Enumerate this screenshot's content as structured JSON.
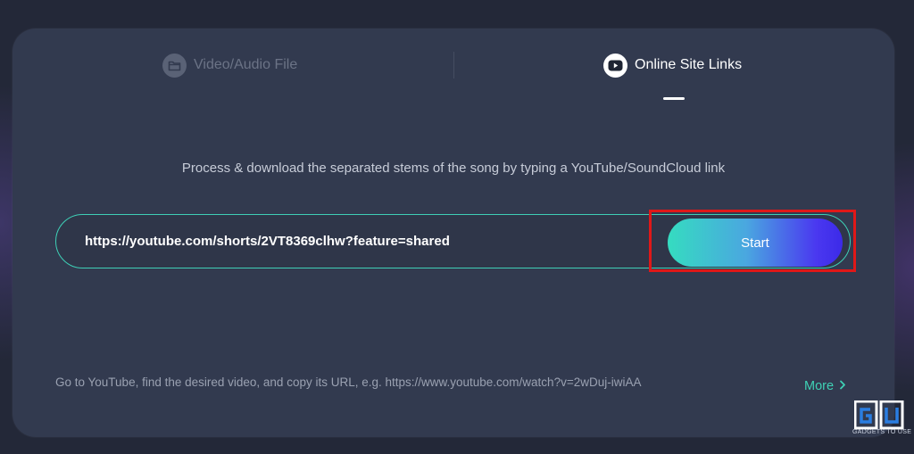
{
  "tabs": [
    {
      "label": "Video/Audio File",
      "icon": "folder-icon",
      "active": false
    },
    {
      "label": "Online Site Links",
      "icon": "youtube-play-icon",
      "active": true
    }
  ],
  "main": {
    "description": "Process & download the separated stems of the song by typing a YouTube/SoundCloud link",
    "url_value": "https://youtube.com/shorts/2VT8369clhw?feature=shared",
    "start_label": "Start",
    "hint": "Go to YouTube, find the desired video, and copy its URL, e.g. https://www.youtube.com/watch?v=2wDuj-iwiAA",
    "more_label": "More"
  },
  "watermark": {
    "logo_text": "GU",
    "caption": "GADGETS TO USE"
  },
  "colors": {
    "background": "#232838",
    "card": "#323a4f",
    "accent_teal": "#3ecfb6",
    "gradient_start": "#35dcc0",
    "gradient_end": "#3c2ae8",
    "highlight_red": "#e01818"
  }
}
